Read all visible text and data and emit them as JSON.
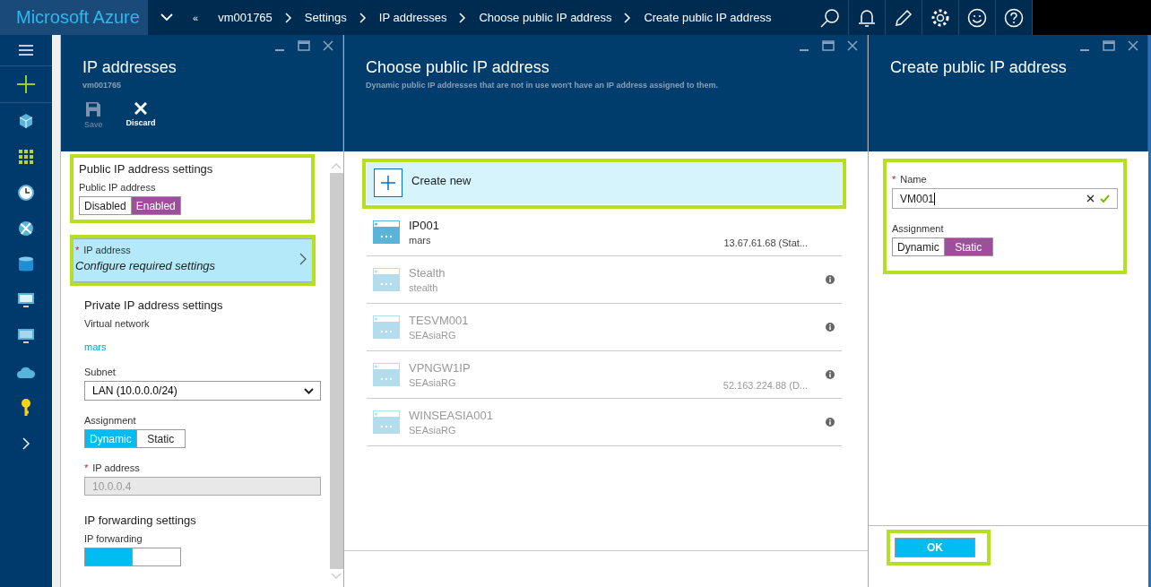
{
  "topbar": {
    "brand": "Microsoft Azure",
    "breadcrumbs": [
      "«",
      "vm001765",
      "Settings",
      "IP addresses",
      "Choose public IP address",
      "Create public IP address"
    ]
  },
  "ip_blade": {
    "title": "IP addresses",
    "subtitle": "vm001765",
    "commands": [
      {
        "label": "Save",
        "kind": "save",
        "disabled": true
      },
      {
        "label": "Discard",
        "kind": "discard",
        "disabled": false
      }
    ],
    "public_section": {
      "heading": "Public IP address settings",
      "highlighted": true,
      "toggle_label": "Public IP address",
      "toggle": {
        "kind": "purple",
        "options": [
          {
            "label": "Disabled",
            "selected": false
          },
          {
            "label": "Enabled",
            "selected": true
          }
        ]
      }
    },
    "ip_link": {
      "label": "IP address",
      "required_mark": "*",
      "value": "Configure required settings",
      "highlighted": true
    },
    "private_section": {
      "heading": "Private IP address settings",
      "vnet_label": "Virtual network",
      "vnet": "mars",
      "subnet_label": "Subnet",
      "subnet": "LAN (10.0.0.0/24)",
      "assignment_label": "Assignment",
      "assignment": {
        "kind": "blue",
        "options": [
          {
            "label": "Dynamic",
            "selected": true
          },
          {
            "label": "Static",
            "selected": false
          }
        ]
      },
      "ip_label": "IP address",
      "ip_required_mark": "*",
      "ip_value": "10.0.0.4"
    },
    "forwarding_section": {
      "heading": "IP forwarding settings",
      "label": "IP forwarding",
      "toggle": {
        "kind": "blue",
        "options": [
          {
            "selected": true
          },
          {
            "selected": false
          }
        ]
      }
    }
  },
  "choose_blade": {
    "title": "Choose public IP address",
    "subtitle": "Dynamic public IP addresses that are not in use won't have an IP address assigned to them.",
    "create_new": {
      "label": "Create new",
      "highlighted": true
    },
    "items": [
      {
        "name": "IP001",
        "group": "mars",
        "address": "13.67.61.68 (Stat...",
        "disabled": false,
        "info": false
      },
      {
        "name": "Stealth",
        "group": "stealth",
        "disabled": true,
        "info": true
      },
      {
        "name": "TESVM001",
        "group": "SEAsiaRG",
        "disabled": true,
        "info": true
      },
      {
        "name": "VPNGW1IP",
        "group": "SEAsiaRG",
        "address": "52.163.224.88 (D...",
        "disabled": true,
        "info": true
      },
      {
        "name": "WINSEASIA001",
        "group": "SEAsiaRG",
        "disabled": true,
        "info": true
      }
    ]
  },
  "create_blade": {
    "title": "Create public IP address",
    "highlighted": true,
    "name_label": "Name",
    "name_required_mark": "*",
    "name_value": "VM001",
    "name_valid": true,
    "assignment_label": "Assignment",
    "assignment": {
      "kind": "purple",
      "options": [
        {
          "label": "Dynamic",
          "selected": false
        },
        {
          "label": "Static",
          "selected": true
        }
      ]
    },
    "ok": "OK",
    "ok_highlighted": true
  }
}
